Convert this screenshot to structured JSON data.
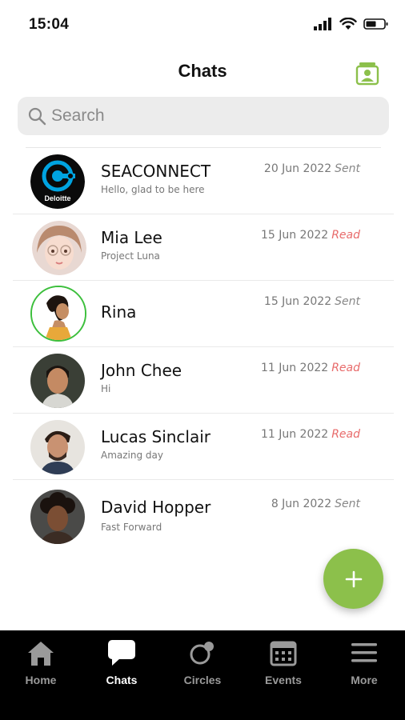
{
  "status_bar": {
    "time": "15:04"
  },
  "header": {
    "title": "Chats"
  },
  "search": {
    "placeholder": "Search"
  },
  "chats": [
    {
      "name": "SEACONNECT",
      "preview": "Hello, glad to be here",
      "date": "20 Jun 2022",
      "status": "Sent",
      "avatar_text": "Deloitte"
    },
    {
      "name": "Mia Lee",
      "preview": "Project Luna",
      "date": "15 Jun 2022",
      "status": "Read"
    },
    {
      "name": "Rina",
      "preview": "",
      "date": "15 Jun 2022",
      "status": "Sent"
    },
    {
      "name": "John Chee",
      "preview": "Hi",
      "date": "11 Jun 2022",
      "status": "Read"
    },
    {
      "name": "Lucas Sinclair",
      "preview": "Amazing day",
      "date": "11 Jun 2022",
      "status": "Read"
    },
    {
      "name": "David Hopper",
      "preview": "Fast Forward",
      "date": "8 Jun 2022",
      "status": "Sent"
    }
  ],
  "tabs": [
    {
      "label": "Home",
      "icon": "home-icon",
      "active": false
    },
    {
      "label": "Chats",
      "icon": "chat-bubble-icon",
      "active": true
    },
    {
      "label": "Circles",
      "icon": "circles-icon",
      "active": false
    },
    {
      "label": "Events",
      "icon": "calendar-icon",
      "active": false
    },
    {
      "label": "More",
      "icon": "menu-icon",
      "active": false
    }
  ],
  "colors": {
    "accent": "#8cc04b",
    "read": "#e86b6b",
    "tab_bar": "#000000",
    "ring": "#3cbf3c"
  }
}
